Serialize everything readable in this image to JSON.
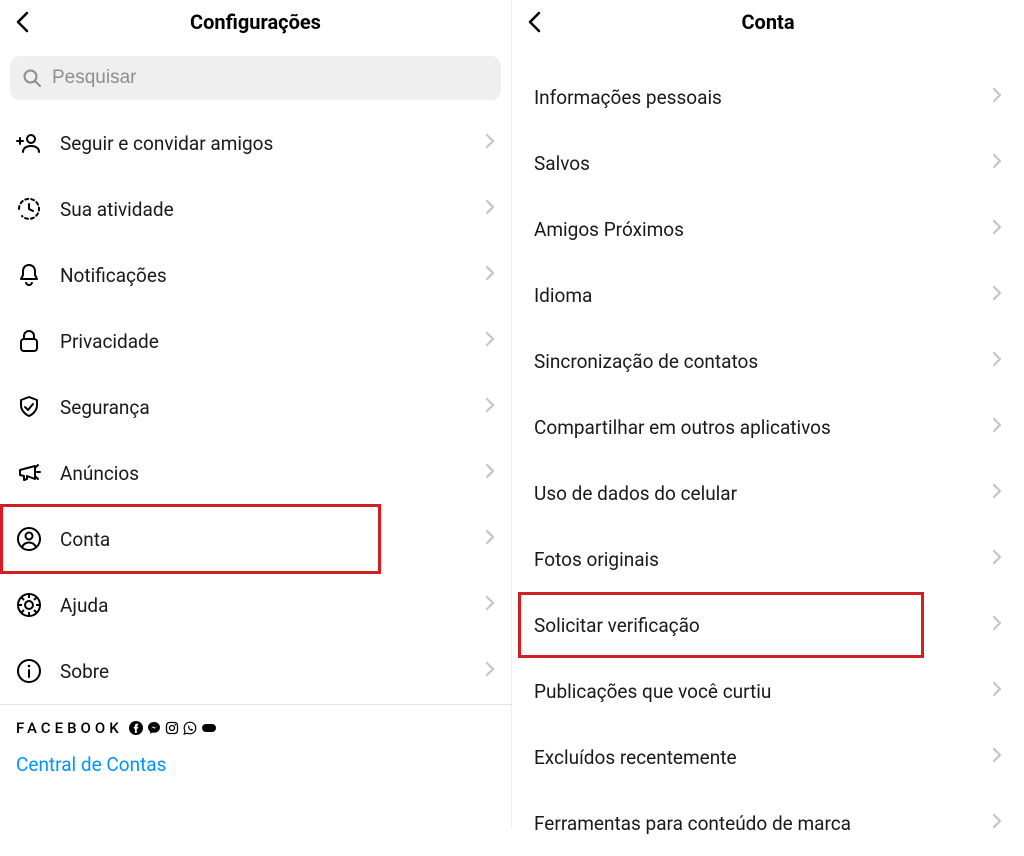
{
  "left": {
    "title": "Configurações",
    "search_placeholder": "Pesquisar",
    "items": [
      {
        "icon": "follow-icon",
        "label": "Seguir e convidar amigos"
      },
      {
        "icon": "activity-icon",
        "label": "Sua atividade"
      },
      {
        "icon": "bell-icon",
        "label": "Notificações"
      },
      {
        "icon": "lock-icon",
        "label": "Privacidade"
      },
      {
        "icon": "shield-icon",
        "label": "Segurança"
      },
      {
        "icon": "megaphone-icon",
        "label": "Anúncios"
      },
      {
        "icon": "account-icon",
        "label": "Conta"
      },
      {
        "icon": "help-icon",
        "label": "Ajuda"
      },
      {
        "icon": "info-icon",
        "label": "Sobre"
      }
    ],
    "facebook_label": "FACEBOOK",
    "accounts_center": "Central de Contas"
  },
  "right": {
    "title": "Conta",
    "items": [
      {
        "label": "Informações pessoais"
      },
      {
        "label": "Salvos"
      },
      {
        "label": "Amigos Próximos"
      },
      {
        "label": "Idioma"
      },
      {
        "label": "Sincronização de contatos"
      },
      {
        "label": "Compartilhar em outros aplicativos"
      },
      {
        "label": "Uso de dados do celular"
      },
      {
        "label": "Fotos originais"
      },
      {
        "label": "Solicitar verificação"
      },
      {
        "label": "Publicações que você curtiu"
      },
      {
        "label": "Excluídos recentemente"
      },
      {
        "label": "Ferramentas para conteúdo de marca"
      }
    ]
  },
  "highlights": {
    "left_index": 6,
    "right_index": 8
  }
}
